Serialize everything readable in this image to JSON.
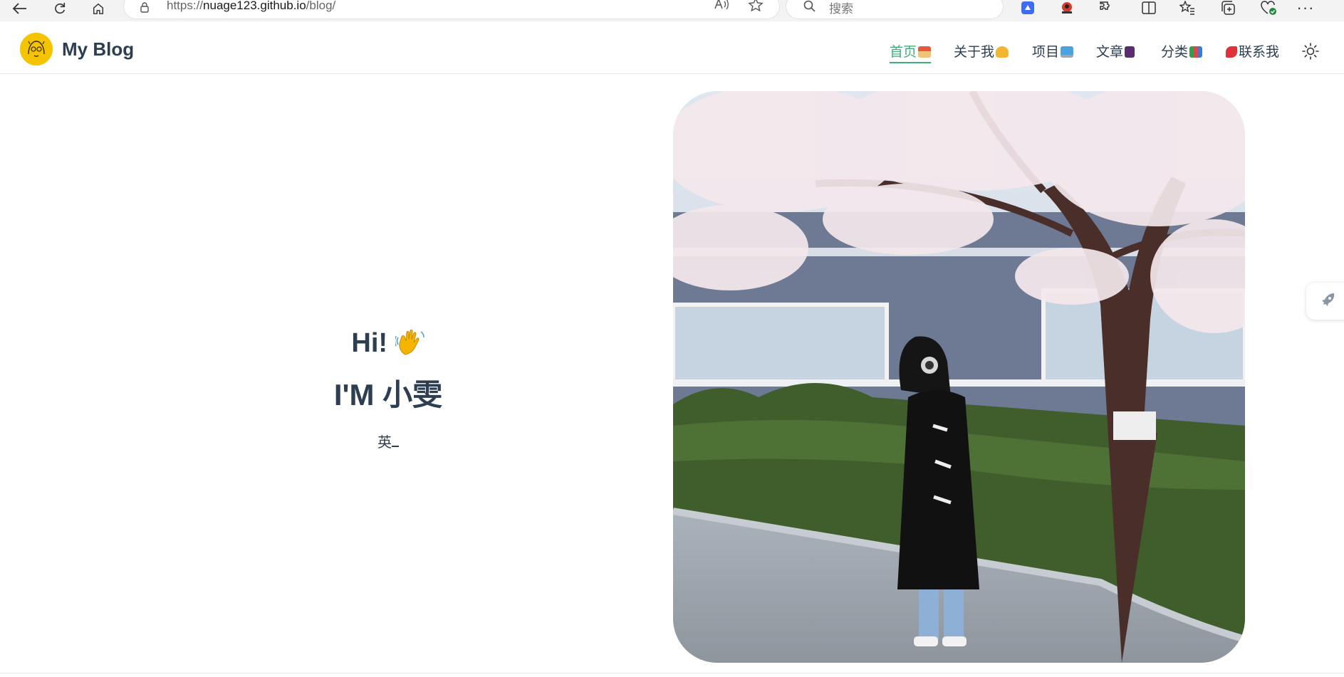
{
  "browser": {
    "url_prefix": "https://",
    "url_host": "nuage123.github.io",
    "url_path": "/blog/",
    "search_placeholder": "搜索",
    "icons": [
      "back-icon",
      "reload-icon",
      "home-icon",
      "lock-icon",
      "read-aloud-icon",
      "favorite-star-icon",
      "search-icon",
      "extension-icon",
      "split-screen-icon",
      "favorites-icon",
      "collections-icon",
      "performance-icon",
      "more-icon"
    ]
  },
  "header": {
    "brand": "My Blog",
    "nav": [
      {
        "label": "首页",
        "emoji": "house-emoji",
        "active": true
      },
      {
        "label": "关于我",
        "emoji": "person-emoji",
        "active": false
      },
      {
        "label": "项目",
        "emoji": "laptop-emoji",
        "active": false
      },
      {
        "label": "文章",
        "emoji": "notebook-emoji",
        "active": false
      },
      {
        "label": "分类",
        "emoji": "books-emoji",
        "active": false
      },
      {
        "label": "联系我",
        "emoji": "telephone-emoji",
        "active": false
      }
    ],
    "accent_color": "#3eaf7c"
  },
  "hero": {
    "greeting": "Hi!",
    "im_prefix": "I'M",
    "name": "小雯",
    "typed_text": "英"
  }
}
